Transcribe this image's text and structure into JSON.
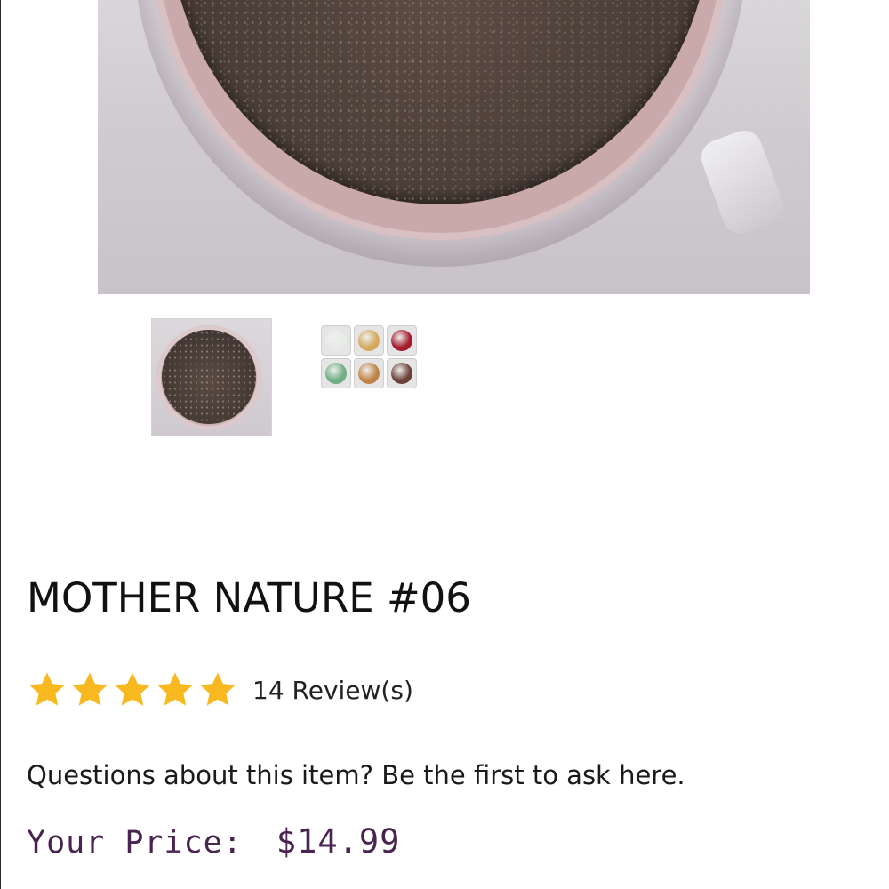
{
  "product": {
    "title": "MOTHER NATURE #06",
    "rating": {
      "stars": 5,
      "max_stars": 5,
      "reviews_text": "14 Review(s)"
    },
    "questions_text": "Questions about this item? Be the first to ask here.",
    "price": {
      "label": "Your Price:",
      "value": "$14.99"
    }
  },
  "gallery": {
    "thumbnails": [
      {
        "name": "single jar thumbnail"
      },
      {
        "name": "six color set thumbnail"
      }
    ],
    "set_colors": [
      "#e7ece6",
      "#d4a95c",
      "#a51c2e",
      "#6fae84",
      "#c08347",
      "#6a4238"
    ]
  },
  "colors": {
    "star": "#f7b820",
    "price": "#4a2450",
    "text": "#111111"
  },
  "icons": {
    "rating_star": "star-icon"
  }
}
